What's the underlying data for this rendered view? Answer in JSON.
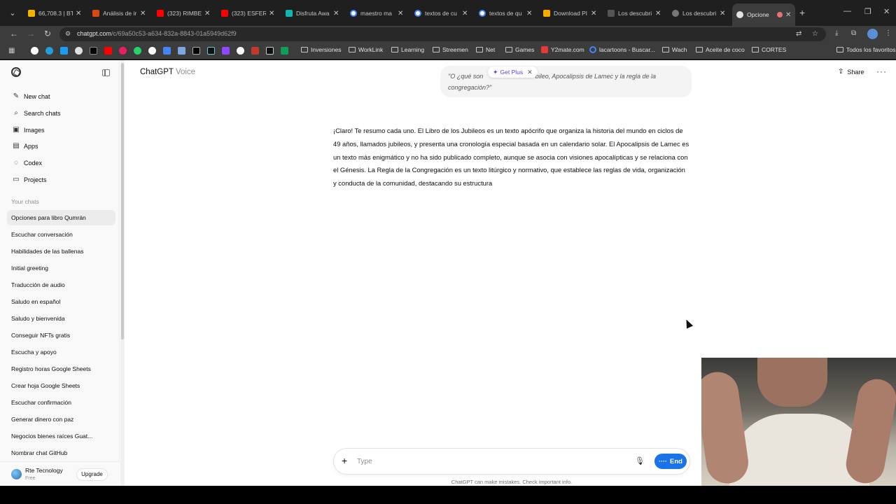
{
  "browser": {
    "tabs": [
      {
        "label": "66,708.3 | BT",
        "color": "#f5b300"
      },
      {
        "label": "Análisis de ir",
        "color": "#d9480f"
      },
      {
        "label": "(323) RIMBE",
        "color": "#ff0000"
      },
      {
        "label": "(323) ESFERA",
        "color": "#ff0000"
      },
      {
        "label": "Disfruta Awa",
        "color": "#12b5b0"
      },
      {
        "label": "maestro ma",
        "color": "#4285f4"
      },
      {
        "label": "textos de cu",
        "color": "#4285f4"
      },
      {
        "label": "textos de qu",
        "color": "#4285f4"
      },
      {
        "label": "Download Pl",
        "color": "#f9ab00"
      },
      {
        "label": "Los descubri",
        "color": "#555555"
      },
      {
        "label": "Los descubri",
        "color": "#777777"
      },
      {
        "label": "Opcione",
        "color": "#e3e3e3"
      }
    ],
    "url_host": "chatgpt.com",
    "url_path": "/c/69a50c53-a634-832a-8843-01a5949d62f9",
    "bookmarks": [
      {
        "label": "Inversiones"
      },
      {
        "label": "WorkLink"
      },
      {
        "label": "Learning"
      },
      {
        "label": "Streemen"
      },
      {
        "label": "Net"
      },
      {
        "label": "Games"
      },
      {
        "label": "Y2mate.com"
      },
      {
        "label": "lacartoons - Buscar..."
      },
      {
        "label": "Wach"
      },
      {
        "label": "Aceite de coco"
      },
      {
        "label": "CORTES"
      },
      {
        "label": "Todos los favoritos"
      }
    ]
  },
  "sidebar": {
    "nav": [
      {
        "label": "New chat",
        "icon": "edit-icon"
      },
      {
        "label": "Search chats",
        "icon": "search-icon"
      },
      {
        "label": "Images",
        "icon": "image-icon"
      },
      {
        "label": "Apps",
        "icon": "apps-icon"
      },
      {
        "label": "Codex",
        "icon": "codex-icon"
      },
      {
        "label": "Projects",
        "icon": "folder-icon"
      }
    ],
    "section_label": "Your chats",
    "chats": [
      "Opciones para libro Qumrán",
      "Escuchar conversación",
      "Habilidades de las ballenas",
      "Initial greeting",
      "Traducción de audio",
      "Saludo en español",
      "Saludo y bienvenida",
      "Conseguir NFTs gratis",
      "Escucha y apoyo",
      "Registro horas Google Sheets",
      "Crear hoja Google Sheets",
      "Escuchar confirmación",
      "Generar dinero con paz",
      "Negocios bienes raíces Guat...",
      "Nombrar chat GitHub"
    ],
    "account": {
      "name": "Rte Tecnology",
      "plan": "Free",
      "upgrade_label": "Upgrade"
    }
  },
  "main": {
    "model_title": "ChatGPT",
    "model_subtitle": "Voice",
    "share_label": "Share",
    "user_message_line1": "\"O ¿qué son ",
    "user_message_line1_end": "bileo, Apocalipsis de Lamec y la regla de la",
    "user_message_line2": "congregación?\"",
    "get_plus_label": "Get Plus",
    "assistant_message": "¡Claro! Te resumo cada uno. El Libro de los Jubileos es un texto apócrifo que organiza la historia del mundo en ciclos de 49 años, llamados jubileos, y presenta una cronología especial basada en un calendario solar. El Apocalipsis de Lamec es un texto más enigmático y no ha sido publicado completo, aunque se asocia con visiones apocalípticas y se relaciona con el Génesis. La Regla de la Congregación es un texto litúrgico y normativo, que establece las reglas de vida, organización y conducta de la comunidad, destacando su estructura",
    "composer_placeholder": "Type",
    "end_label": "End",
    "disclaimer": "ChatGPT can make mistakes. Check important info."
  }
}
